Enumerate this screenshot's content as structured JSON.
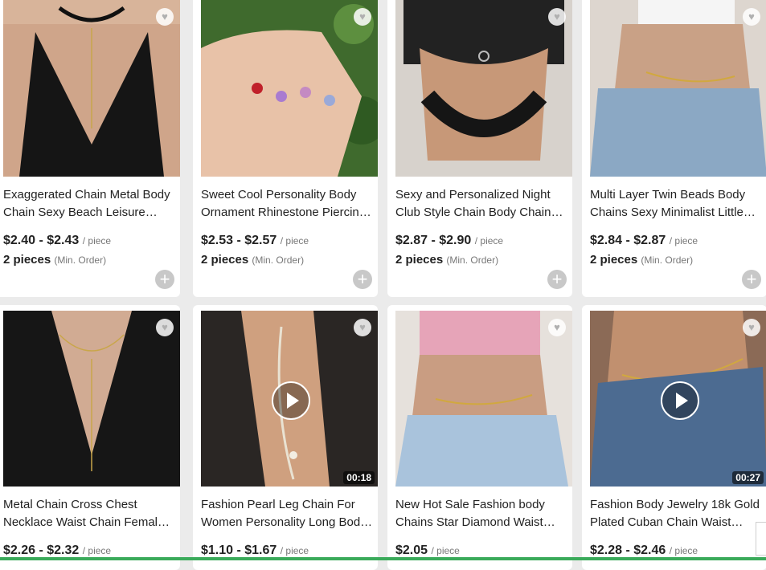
{
  "products": [
    {
      "title": "Exaggerated Chain Metal Body Chain Sexy Beach Leisure Multilayer Waist Chain",
      "price": "$2.40 - $2.43",
      "unit": "/ piece",
      "moq": "2 pieces",
      "moq_note": "(Min. Order)"
    },
    {
      "title": "Sweet Cool Personality Body Ornament Rhinestone Piercing Navel Ring",
      "price": "$2.53 - $2.57",
      "unit": "/ piece",
      "moq": "2 pieces",
      "moq_note": "(Min. Order)"
    },
    {
      "title": "Sexy and Personalized Night Club Style Chain Body Chains Leg Chain",
      "price": "$2.87 - $2.90",
      "unit": "/ piece",
      "moq": "2 pieces",
      "moq_note": "(Min. Order)"
    },
    {
      "title": "Multi Layer Twin Beads Body Chains Sexy Minimalist Little Beads Waist Chain",
      "price": "$2.84 - $2.87",
      "unit": "/ piece",
      "moq": "2 pieces",
      "moq_note": "(Min. Order)"
    },
    {
      "title": "Metal Chain Cross Chest Necklace Waist Chain Female Body Jewelry",
      "price": "$2.26 - $2.32",
      "unit": "/ piece"
    },
    {
      "title": "Fashion Pearl Leg Chain For Women Personality Long Body Chain",
      "price": "$1.10 - $1.67",
      "unit": "/ piece",
      "duration": "00:18"
    },
    {
      "title": "New Hot Sale Fashion body Chains Star Diamond Waist Chain",
      "price": "$2.05",
      "unit": "/ piece"
    },
    {
      "title": "Fashion Body Jewelry 18k Gold Plated Cuban Chain Waist Chain",
      "price": "$2.28 - $2.46",
      "unit": "/ piece",
      "duration": "00:27"
    }
  ],
  "icons": {
    "favorite": "heart-icon",
    "add": "plus-icon",
    "play": "play-icon"
  },
  "colors": {
    "accent_bar": "#3aaa5a",
    "background": "#ebebeb"
  }
}
